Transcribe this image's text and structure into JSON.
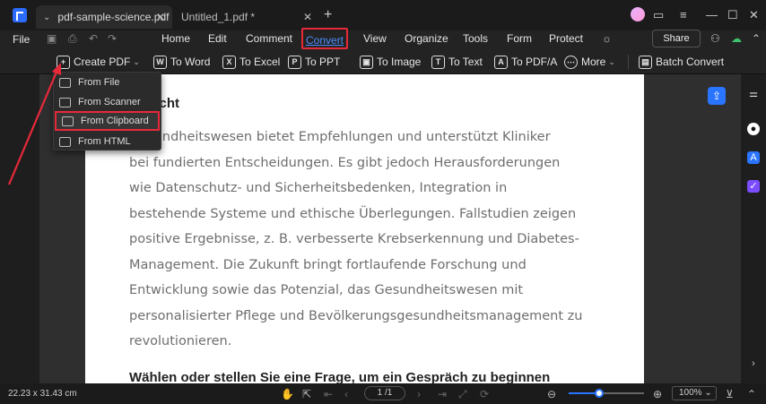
{
  "titlebar": {
    "tabs": [
      {
        "label": "pdf-sample-science.pdf",
        "active": true
      },
      {
        "label": "Untitled_1.pdf *",
        "active": false
      }
    ],
    "new_tab": "+"
  },
  "menubar": {
    "file": "File",
    "items": [
      "Home",
      "Edit",
      "Comment",
      "Convert",
      "View",
      "Organize",
      "Tools",
      "Form",
      "Protect"
    ],
    "active_item": "Convert",
    "share": "Share"
  },
  "toolbar": {
    "create_pdf": "Create PDF",
    "buttons": [
      {
        "label": "To Word",
        "icon": "W"
      },
      {
        "label": "To Excel",
        "icon": "X"
      },
      {
        "label": "To PPT",
        "icon": "P"
      },
      {
        "label": "To Image",
        "icon": "▣"
      },
      {
        "label": "To Text",
        "icon": "T"
      },
      {
        "label": "To PDF/A",
        "icon": "A"
      }
    ],
    "more": "More",
    "batch_convert": "Batch Convert"
  },
  "dropdown": {
    "items": [
      "From File",
      "From Scanner",
      "From Clipboard",
      "From HTML"
    ],
    "highlighted": "From Clipboard"
  },
  "document": {
    "heading_top": "sicht",
    "paragraph_lines": [
      "Gesundheitswesen bietet Empfehlungen und unterstützt Kliniker",
      "bei fundierten Entscheidungen.   Es gibt jedoch Herausforderungen",
      "wie Datenschutz- und Sicherheitsbedenken, Integration in",
      "bestehende Systeme und ethische Überlegungen. Fallstudien zeigen",
      "positive Ergebnisse, z. B.   verbesserte Krebserkennung und Diabetes-",
      "Management. Die Zukunft bringt fortlaufende Forschung   und",
      "Entwicklung sowie das Potenzial, das Gesundheitswesen mit",
      "personalisierter Pflege und Bevölkerungsgesundheitsmanagement zu",
      "revolutionieren."
    ],
    "heading_bottom": "Wählen oder stellen Sie eine Frage, um ein Gespräch zu beginnen"
  },
  "statusbar": {
    "dimensions": "22.23 x 31.43 cm",
    "page": "1 /1",
    "zoom": "100%",
    "zoom_level": 0.4
  },
  "colors": {
    "accent": "#2a75ff",
    "highlight_red": "#e8293a"
  }
}
